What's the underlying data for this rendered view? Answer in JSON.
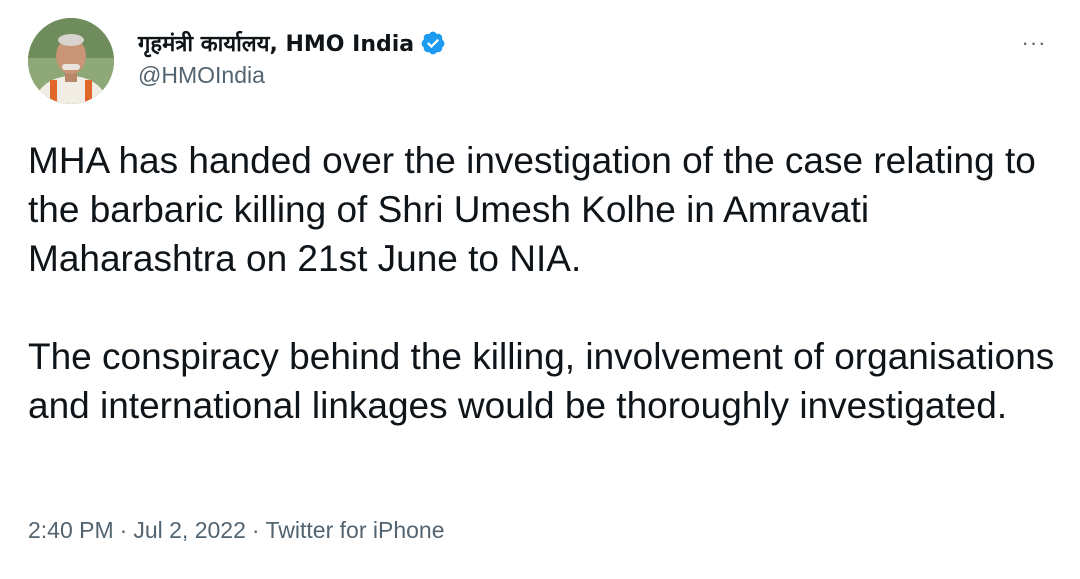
{
  "tweet": {
    "author": {
      "display_name": "गृहमंत्री कार्यालय, HMO India",
      "handle": "@HMOIndia",
      "verified": true,
      "verified_icon": "verified-badge-icon",
      "avatar_icon": "profile-avatar"
    },
    "more_icon": "more-options-icon",
    "more_glyph": "···",
    "paragraphs": [
      "MHA has handed over the investigation of the case relating to the barbaric killing of Shri Umesh Kolhe in Amravati Maharashtra on 21st June to NIA.",
      "The conspiracy behind the killing, involvement of organisations and international linkages would be thoroughly investigated."
    ],
    "meta": {
      "time": "2:40 PM",
      "separator_1": "·",
      "date": "Jul 2, 2022",
      "separator_2": "·",
      "source": "Twitter for iPhone"
    },
    "colors": {
      "text": "#0f1419",
      "secondary": "#536471",
      "verified": "#1d9bf0",
      "background": "#ffffff"
    }
  }
}
